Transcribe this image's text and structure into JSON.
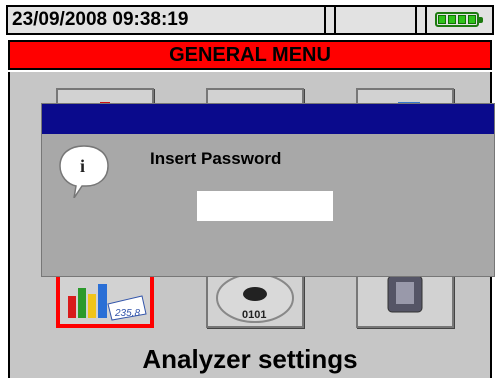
{
  "status_bar": {
    "datetime": "23/09/2008 09:38:19",
    "battery_icon": "battery-full-icon"
  },
  "header": {
    "title": "GENERAL MENU"
  },
  "menu_tiles": [
    {
      "name": "tile-top-1",
      "selected": false
    },
    {
      "name": "tile-top-2",
      "selected": false
    },
    {
      "name": "tile-top-3",
      "selected": false
    },
    {
      "name": "tile-analyzer-settings",
      "selected": true
    },
    {
      "name": "tile-data-disc",
      "selected": false
    },
    {
      "name": "tile-memory-card",
      "selected": false
    }
  ],
  "footer": {
    "label": "Analyzer settings"
  },
  "dialog": {
    "icon": "info-icon",
    "label": "Insert Password",
    "password_value": ""
  },
  "colors": {
    "title_bar": "#ff0000",
    "dialog_titlebar": "#0a0a8c",
    "background": "#c6c6c6",
    "battery": "#2fc21a"
  }
}
